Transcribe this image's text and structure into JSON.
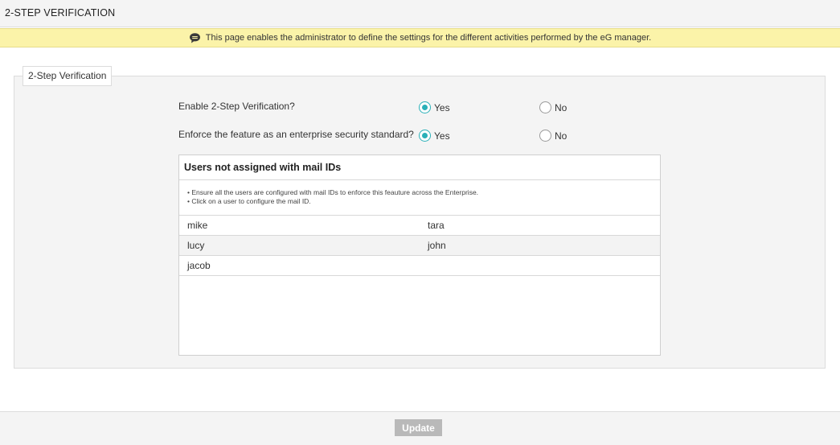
{
  "header": {
    "title": "2-STEP VERIFICATION"
  },
  "banner": {
    "icon": "speech-bubble-icon",
    "text": "This page enables the administrator to define the settings for the different activities performed by the eG manager."
  },
  "section": {
    "legend": "2-Step Verification",
    "questions": [
      {
        "label": "Enable 2-Step Verification?",
        "yes_label": "Yes",
        "no_label": "No",
        "selected": "Yes"
      },
      {
        "label": "Enforce the feature as an enterprise security standard?",
        "yes_label": "Yes",
        "no_label": "No",
        "selected": "Yes"
      }
    ]
  },
  "users_panel": {
    "title": "Users not assigned with mail IDs",
    "notes": [
      "• Ensure all the users are configured with mail IDs to enforce this feauture across the Enterprise.",
      "• Click on a user to configure the mail ID."
    ],
    "users": [
      [
        "mike",
        "tara"
      ],
      [
        "lucy",
        "john"
      ],
      [
        "jacob",
        ""
      ]
    ]
  },
  "footer": {
    "update_label": "Update"
  },
  "colors": {
    "accent": "#2ab0b8",
    "banner_bg": "#fbf3a9",
    "button_disabled": "#b9b9b9"
  }
}
